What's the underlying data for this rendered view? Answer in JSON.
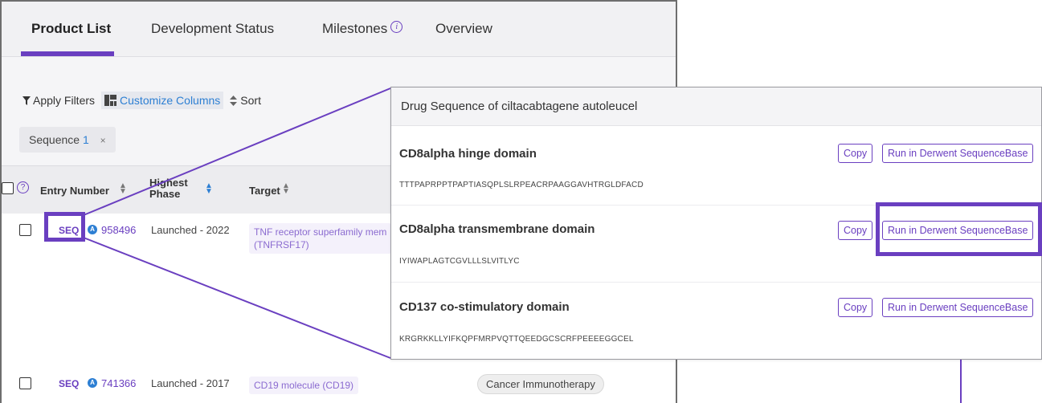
{
  "tabs": [
    {
      "label": "Product List"
    },
    {
      "label": "Development Status"
    },
    {
      "label": "Milestones"
    },
    {
      "label": "Overview"
    }
  ],
  "milestones_info_icon": "i",
  "toolbar": {
    "apply_filters": "Apply Filters",
    "customize_columns": "Customize Columns",
    "sort": "Sort"
  },
  "filter_chip": {
    "label": "Sequence",
    "count": "1",
    "close": "×"
  },
  "table": {
    "headers": {
      "entry_number": "Entry Number",
      "highest_phase_1": "Highest",
      "highest_phase_2": "Phase",
      "target": "Target"
    },
    "help_icon": "?",
    "rows": [
      {
        "seq": "SEQ",
        "badge": "A",
        "entry": "958496",
        "phase": "Launched - 2022",
        "target_1": "TNF receptor superfamily mem",
        "target_2": "(TNFRSF17)"
      },
      {
        "seq": "SEQ",
        "badge": "A",
        "entry": "741366",
        "phase": "Launched - 2017",
        "target_1": "CD19 molecule (CD19)",
        "pill": "Cancer Immunotherapy"
      }
    ]
  },
  "popup": {
    "title": "Drug Sequence of ciltacabtagene autoleucel",
    "domains": [
      {
        "name": "CD8alpha hinge domain",
        "sequence": "TTTPAPRPPTPAPTIASQPLSLRPEACRPAAGGAVHTRGLDFACD",
        "copy": "Copy",
        "run": "Run in Derwent SequenceBase"
      },
      {
        "name": "CD8alpha transmembrane domain",
        "sequence": "IYIWAPLAGTCGVLLLSLVITLYC",
        "copy": "Copy",
        "run": "Run in Derwent SequenceBase"
      },
      {
        "name": "CD137 co-stimulatory domain",
        "sequence": "KRGRKKLLYIFKQPFMRPVQTTQEEDGCSCRFPEEEEGGCEL",
        "copy": "Copy",
        "run": "Run in Derwent SequenceBase"
      }
    ]
  },
  "colors": {
    "accent": "#6a3fc0",
    "link_blue": "#2d7fd3"
  }
}
